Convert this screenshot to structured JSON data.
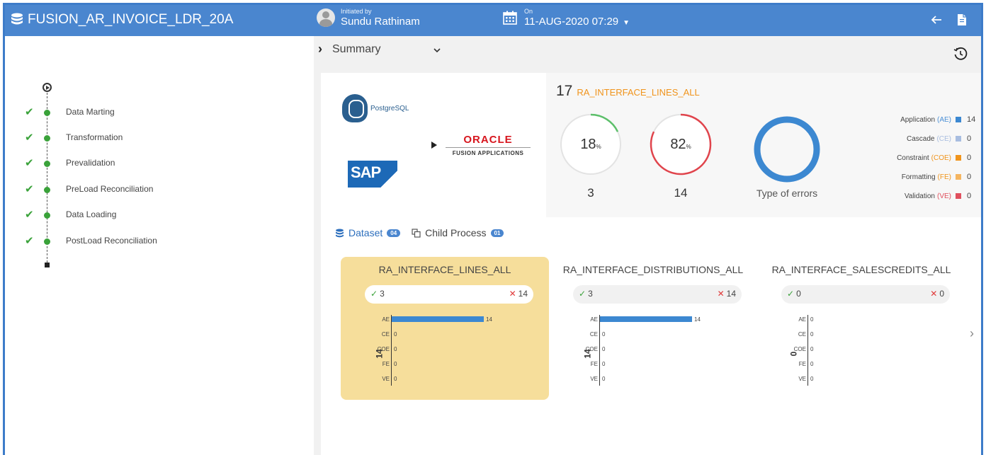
{
  "header": {
    "title": "FUSION_AR_INVOICE_LDR_20A",
    "initiated_label": "Initiated by",
    "initiated_by": "Sundu Rathinam",
    "on_label": "On",
    "date": "11-AUG-2020 07:29",
    "accent": "#4a86cf"
  },
  "pipeline": {
    "steps": [
      {
        "label": "Data Marting",
        "status": "done"
      },
      {
        "label": "Transformation",
        "status": "done"
      },
      {
        "label": "Prevalidation",
        "status": "done"
      },
      {
        "label": "PreLoad Reconciliation",
        "status": "done"
      },
      {
        "label": "Data Loading",
        "status": "done"
      },
      {
        "label": "PostLoad Reconciliation",
        "status": "done"
      }
    ]
  },
  "summary": {
    "label": "Summary",
    "logos": {
      "pg_text": "PostgreSQL",
      "sap_text": "SAP",
      "oracle_name": "ORACLE",
      "oracle_sub": "FUSION APPLICATIONS"
    },
    "total": "17",
    "table_name": "RA_INTERFACE_LINES_ALL",
    "success_pct": "18",
    "error_pct": "82",
    "pct_symbol": "%",
    "success_count": "3",
    "error_count": "14",
    "errors_label": "Type of errors",
    "legend": [
      {
        "name": "Application",
        "abbr": "(AE)",
        "value": "14",
        "color": "#3c88d1",
        "abbr_class": "blue"
      },
      {
        "name": "Cascade",
        "abbr": "(CE)",
        "value": "0",
        "color": "#a8bde0",
        "abbr_class": "light"
      },
      {
        "name": "Constraint",
        "abbr": "(COE)",
        "value": "0",
        "color": "#f0941c",
        "abbr_class": ""
      },
      {
        "name": "Formatting",
        "abbr": "(FE)",
        "value": "0",
        "color": "#f5b560",
        "abbr_class": ""
      },
      {
        "name": "Validation",
        "abbr": "(VE)",
        "value": "0",
        "color": "#e0505e",
        "abbr_class": "red"
      }
    ]
  },
  "tabs": {
    "dataset_label": "Dataset",
    "dataset_count": "04",
    "child_label": "Child Process",
    "child_count": "01"
  },
  "datasets": [
    {
      "name": "RA_INTERFACE_LINES_ALL",
      "ok": "3",
      "err": "14",
      "axis_total": "14",
      "bars": [
        {
          "k": "AE",
          "v": 14
        },
        {
          "k": "CE",
          "v": 0
        },
        {
          "k": "COE",
          "v": 0
        },
        {
          "k": "FE",
          "v": 0
        },
        {
          "k": "VE",
          "v": 0
        }
      ]
    },
    {
      "name": "RA_INTERFACE_DISTRIBUTIONS_ALL",
      "ok": "3",
      "err": "14",
      "axis_total": "14",
      "bars": [
        {
          "k": "AE",
          "v": 14
        },
        {
          "k": "CE",
          "v": 0
        },
        {
          "k": "COE",
          "v": 0
        },
        {
          "k": "FE",
          "v": 0
        },
        {
          "k": "VE",
          "v": 0
        }
      ]
    },
    {
      "name": "RA_INTERFACE_SALESCREDITS_ALL",
      "ok": "0",
      "err": "0",
      "axis_total": "0",
      "bars": [
        {
          "k": "AE",
          "v": 0
        },
        {
          "k": "CE",
          "v": 0
        },
        {
          "k": "COE",
          "v": 0
        },
        {
          "k": "FE",
          "v": 0
        },
        {
          "k": "VE",
          "v": 0
        }
      ]
    }
  ]
}
